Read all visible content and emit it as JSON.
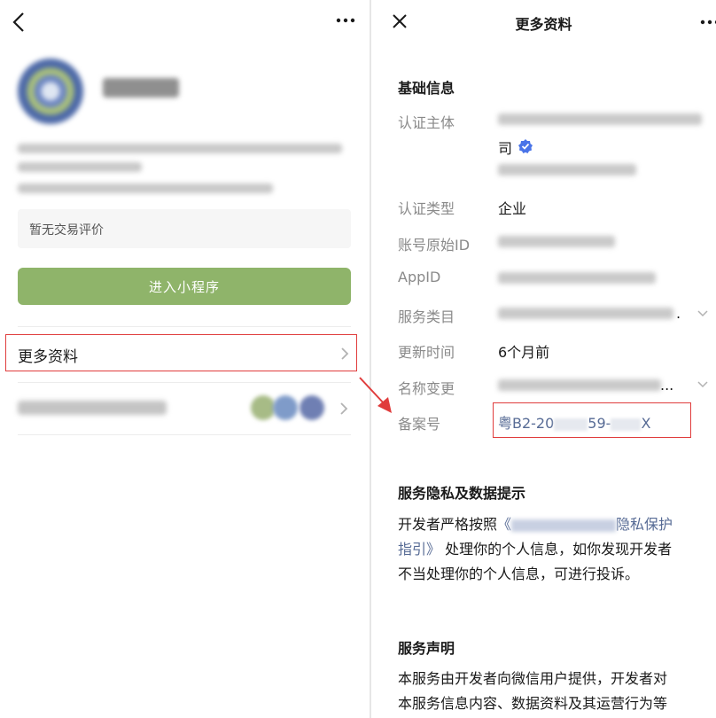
{
  "left": {
    "review_placeholder": "暂无交易评价",
    "enter_button": "进入小程序",
    "more_info_label": "更多资料"
  },
  "right": {
    "title": "更多资料",
    "basic_section_title": "基础信息",
    "fields": {
      "subject_label": "认证主体",
      "subject_value_tail": "司",
      "type_label": "认证类型",
      "type_value": "企业",
      "original_id_label": "账号原始ID",
      "appid_label": "AppID",
      "category_label": "服务类目",
      "update_label": "更新时间",
      "update_value": "6个月前",
      "rename_label": "名称变更",
      "rename_suffix": "...",
      "category_suffix": ".",
      "beian_label": "备案号",
      "beian_part1": "粤B2-20",
      "beian_part2": "59-",
      "beian_part3": "X"
    },
    "privacy_section_title": "服务隐私及数据提示",
    "privacy_line1_prefix": "开发者严格按照",
    "privacy_link_open": "《",
    "privacy_link_tail": "隐私保护",
    "privacy_link_line2": "指引》",
    "privacy_line2_rest": "处理你的个人信息，如你发现开发者",
    "privacy_line3": "不当处理你的个人信息，可进行投诉。",
    "statement_section_title": "服务声明",
    "statement_line1": "本服务由开发者向微信用户提供，开发者对",
    "statement_line2": "本服务信息内容、数据资料及其运营行为等"
  },
  "colors": {
    "accent_green": "#8fb46a",
    "link_blue": "#576b95",
    "highlight_red": "#e03c3c",
    "verified_blue": "#4a74e8"
  },
  "icons": [
    "back-icon",
    "more-icon",
    "chevron-right-icon",
    "close-icon",
    "verified-icon",
    "chevron-down-icon",
    "red-arrow-icon"
  ]
}
